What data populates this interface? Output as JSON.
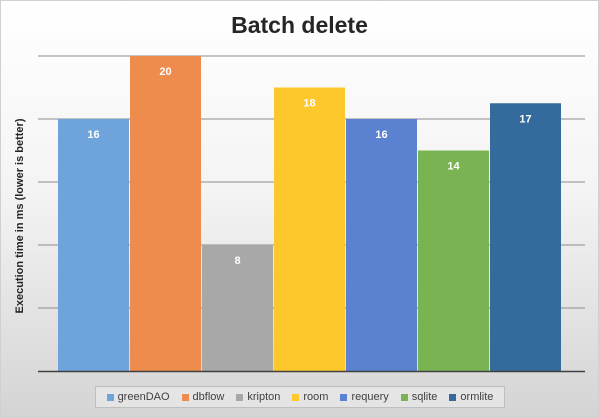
{
  "chart_data": {
    "type": "bar",
    "title": "Batch delete",
    "ylabel": "Execution time in ms (lower is better)",
    "xlabel": "",
    "ylim": [
      0,
      20
    ],
    "grid": true,
    "legend_position": "bottom",
    "series": [
      {
        "name": "greenDAO",
        "value": 16,
        "color": "#6fa3dc"
      },
      {
        "name": "dbflow",
        "value": 20,
        "color": "#ee8c4e"
      },
      {
        "name": "kripton",
        "value": 8,
        "color": "#a8a8a8"
      },
      {
        "name": "room",
        "value": 18,
        "color": "#fdc82b"
      },
      {
        "name": "requery",
        "value": 16,
        "color": "#5a82d0"
      },
      {
        "name": "sqlite",
        "value": 14,
        "color": "#79b352"
      },
      {
        "name": "ormlite",
        "value": 17,
        "color": "#356a9c"
      }
    ]
  }
}
